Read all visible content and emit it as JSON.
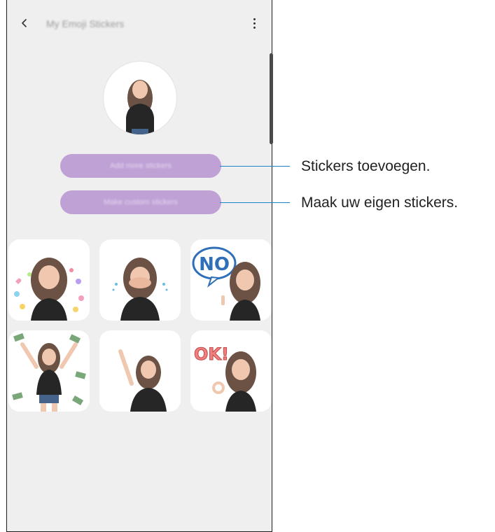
{
  "screen": {
    "title": "My Emoji Stickers",
    "add_button": "Add more stickers",
    "custom_button": "Make custom stickers"
  },
  "icons": {
    "back": "chevron-left-icon",
    "more": "more-vertical-icon"
  },
  "stickers": [
    {
      "name": "sticker-hearts"
    },
    {
      "name": "sticker-crying"
    },
    {
      "name": "sticker-no",
      "text": "NO"
    },
    {
      "name": "sticker-money"
    },
    {
      "name": "sticker-wave"
    },
    {
      "name": "sticker-ok",
      "text": "OK!"
    }
  ],
  "callouts": [
    {
      "label": "Stickers toevoegen."
    },
    {
      "label": "Maak uw eigen stickers."
    }
  ],
  "colors": {
    "button": "#bfa1d6",
    "callout_line": "#1b84c7",
    "screen_bg": "#efefef"
  }
}
